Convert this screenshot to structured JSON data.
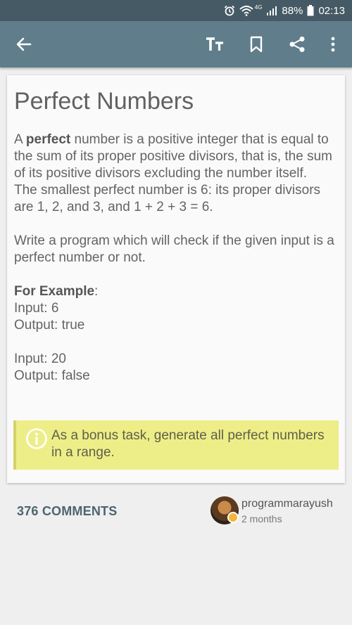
{
  "status_bar": {
    "network": "4G",
    "battery": "88%",
    "time": "02:13",
    "icons": [
      "alarm-icon",
      "wifi-icon",
      "signal-icon",
      "battery-icon"
    ]
  },
  "toolbar": {
    "icons": [
      "back-arrow-icon",
      "text-size-icon",
      "bookmark-icon",
      "share-icon",
      "more-vert-icon"
    ]
  },
  "article": {
    "title": "Perfect Numbers",
    "intro_prefix": "A ",
    "intro_bold": "perfect",
    "intro_rest": " number is a positive integer that is equal to the sum of its proper positive divisors, that is, the sum of its positive divisors excluding the number itself.",
    "smallest": "The smallest perfect number is 6: its proper divisors are 1, 2, and 3, and 1 + 2 + 3 = 6.",
    "task": "Write a program which will check if the given input is a perfect number or not.",
    "example_heading": "For Example",
    "example_colon": ":",
    "examples": [
      {
        "input": "Input: 6",
        "output": "Output: true"
      },
      {
        "input": "Input: 20",
        "output": "Output: false"
      }
    ],
    "note": "As a bonus task, generate all perfect numbers in a range."
  },
  "footer": {
    "comments_label": "376 COMMENTS",
    "author_name": "programmarayush",
    "author_time": "2 months"
  },
  "colors": {
    "status_bar": "#455a64",
    "app_bar": "#607d8b",
    "note_bg": "#eeee88",
    "note_border": "#d4d26a"
  }
}
